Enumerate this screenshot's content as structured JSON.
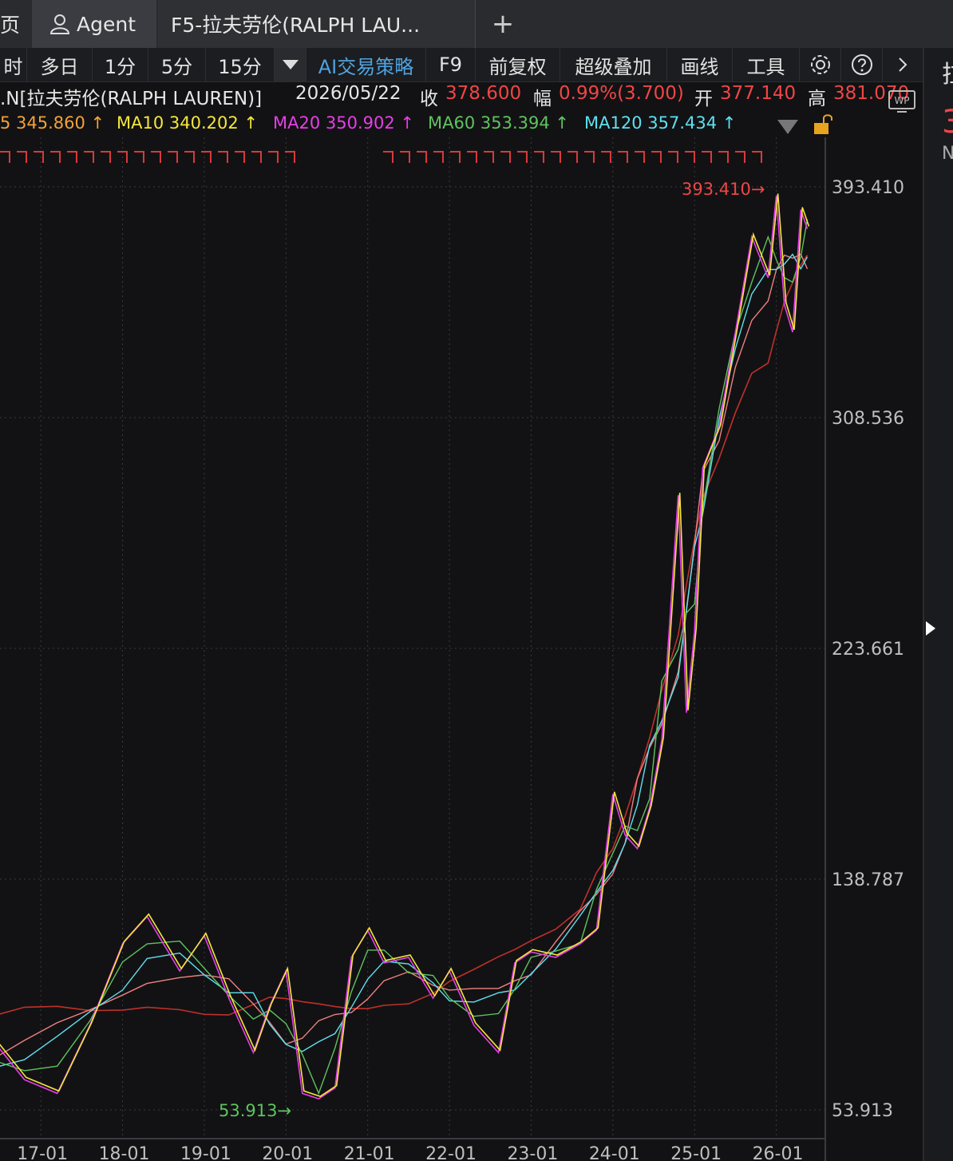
{
  "tabs": [
    {
      "label": "页"
    },
    {
      "label": "Agent"
    },
    {
      "label": "F5-拉夫劳伦(RALPH LAU..."
    }
  ],
  "add_tab_label": "+",
  "toolbar": {
    "items": [
      "时",
      "多日",
      "1分",
      "5分",
      "15分",
      "",
      "AI交易策略",
      "F9",
      "前复权",
      "超级叠加",
      "画线",
      "工具"
    ]
  },
  "info": {
    "name": ".N[拉夫劳伦(RALPH LAUREN)]",
    "date": "2026/05/22",
    "close_label": "收",
    "close": "378.600",
    "change_label": "幅",
    "change": "0.99%(3.700)",
    "open_label": "开",
    "open": "377.140",
    "high_label": "高",
    "high": "381.070"
  },
  "ma": [
    {
      "label": "5 345.860 ↑",
      "color": "#f2a23a"
    },
    {
      "label": "MA10 340.202 ↑",
      "color": "#f5e63c"
    },
    {
      "label": "MA20 350.902 ↑",
      "color": "#e83ee8"
    },
    {
      "label": "MA60 353.394 ↑",
      "color": "#5fc35f"
    },
    {
      "label": "MA120 357.434 ↑",
      "color": "#5fe0f0"
    }
  ],
  "right_strip": {
    "char": "拉",
    "big": "3",
    "letter": "N"
  },
  "chart_data": {
    "type": "line",
    "y_ticks": [
      "393.410",
      "308.536",
      "223.661",
      "138.787",
      "53.913"
    ],
    "ylim": [
      53.913,
      393.41
    ],
    "x_ticks": [
      "17-01",
      "18-01",
      "19-01",
      "20-01",
      "21-01",
      "22-01",
      "23-01",
      "24-01",
      "25-01",
      "26-01"
    ],
    "max_annotation": "393.410",
    "min_annotation": "53.913",
    "series": [
      {
        "color": "#f5e63c",
        "x": [
          2016.0,
          2016.4,
          2016.8,
          2017.2,
          2017.6,
          2018.0,
          2018.3,
          2018.7,
          2019.0,
          2019.3,
          2019.6,
          2019.8,
          2020.0,
          2020.2,
          2020.4,
          2020.6,
          2020.8,
          2021.0,
          2021.2,
          2021.5,
          2021.8,
          2022.0,
          2022.3,
          2022.6,
          2022.8,
          2023.0,
          2023.3,
          2023.6,
          2023.8,
          2024.0,
          2024.15,
          2024.3,
          2024.45,
          2024.6,
          2024.8,
          2024.9,
          2025.0,
          2025.1,
          2025.3,
          2025.5,
          2025.7,
          2025.9,
          2026.0,
          2026.1,
          2026.2,
          2026.3,
          2026.38
        ],
        "values": [
          72,
          80,
          65,
          60,
          85,
          115,
          125,
          105,
          118,
          95,
          75,
          92,
          105,
          60,
          58,
          62,
          110,
          120,
          108,
          110,
          95,
          105,
          85,
          75,
          108,
          112,
          110,
          115,
          120,
          170,
          155,
          150,
          165,
          190,
          280,
          200,
          230,
          290,
          305,
          340,
          375,
          360,
          390,
          350,
          340,
          385,
          378
        ]
      }
    ]
  }
}
